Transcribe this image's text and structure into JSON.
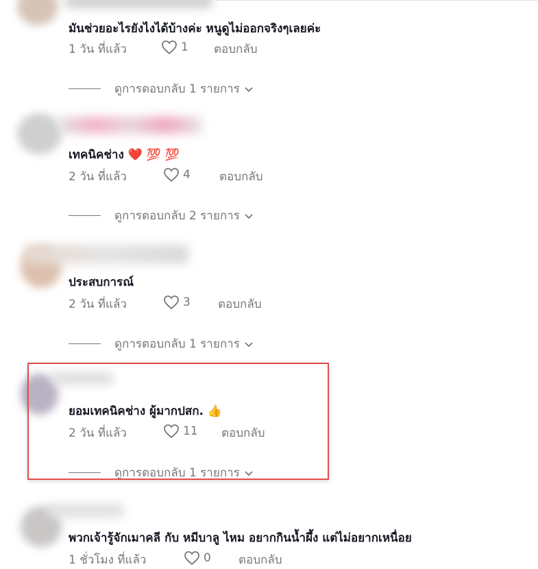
{
  "comments": [
    {
      "text": "มันช่วยอะไรยังไงได้บ้างค่ะ หนูดูไม่ออกจริงๆเลยค่ะ",
      "time": "1 วัน ที่แล้ว",
      "likes": "1",
      "reply": "ตอบกลับ",
      "view_replies": "ดูการตอบกลับ 1 รายการ"
    },
    {
      "text": "เทคนิคช่าง ❤️ 💯 💯",
      "time": "2 วัน ที่แล้ว",
      "likes": "4",
      "reply": "ตอบกลับ",
      "view_replies": "ดูการตอบกลับ 2 รายการ"
    },
    {
      "text": "ประสบการณ์",
      "time": "2 วัน ที่แล้ว",
      "likes": "3",
      "reply": "ตอบกลับ",
      "view_replies": "ดูการตอบกลับ 1 รายการ"
    },
    {
      "text": "ยอมเทคนิคช่าง ผู้มากปสก. 👍",
      "time": "2 วัน ที่แล้ว",
      "likes": "11",
      "reply": "ตอบกลับ",
      "view_replies": "ดูการตอบกลับ 1 รายการ"
    },
    {
      "text": "พวกเจ้ารู้จักเมาคลี กับ หมีบาลู ไหม อยากกินน้ำผึ้ง แต่ไม่อยากเหนื่อย",
      "time": "1 ชั่วโมง ที่แล้ว",
      "likes": "0",
      "reply": "ตอบกลับ"
    }
  ],
  "icons": {
    "like": "heart-outline-icon",
    "expand": "chevron-down-icon"
  },
  "colors": {
    "highlight_border": "#e04b4b",
    "meta_text": "#75767c"
  }
}
